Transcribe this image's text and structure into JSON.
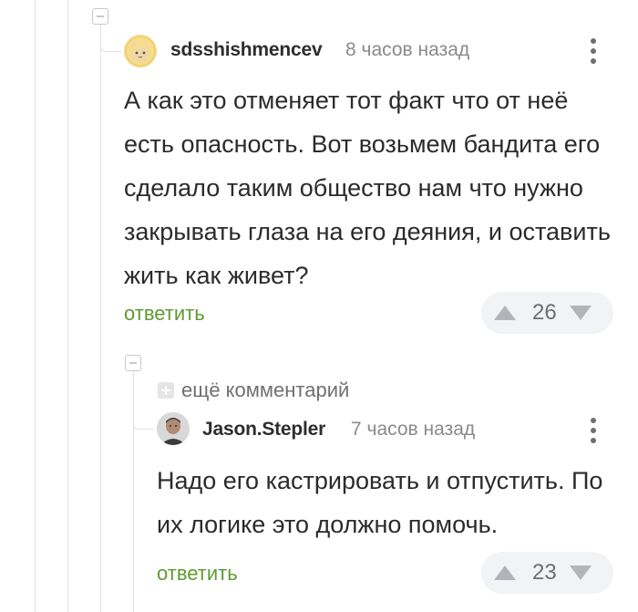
{
  "comments": [
    {
      "username": "sdsshishmencev",
      "time": "8 часов назад",
      "text": "А как это отменяет тот факт что от неё есть опасность. Вот возьмем бандита его сделало таким общество нам что нужно закрывать глаза на его деяния, и оставить жить как живет?",
      "reply_label": "ответить",
      "rating": "26"
    },
    {
      "username": "Jason.Stepler",
      "time": "7 часов назад",
      "text": "Надо его кастрировать и отпустить. По их логике это должно помочь.",
      "reply_label": "ответить",
      "rating": "23"
    }
  ],
  "more_comments_label": "ещё комментарий",
  "icons": {
    "collapse": "collapse-minus-icon",
    "more": "vertical-dots-icon",
    "upvote": "triangle-up-icon",
    "downvote": "triangle-down-icon",
    "expand": "plus-square-icon"
  },
  "colors": {
    "reply_link": "#5f9a32",
    "thread_line": "#e2e2e2",
    "rating_bg": "#f2f3f5"
  }
}
